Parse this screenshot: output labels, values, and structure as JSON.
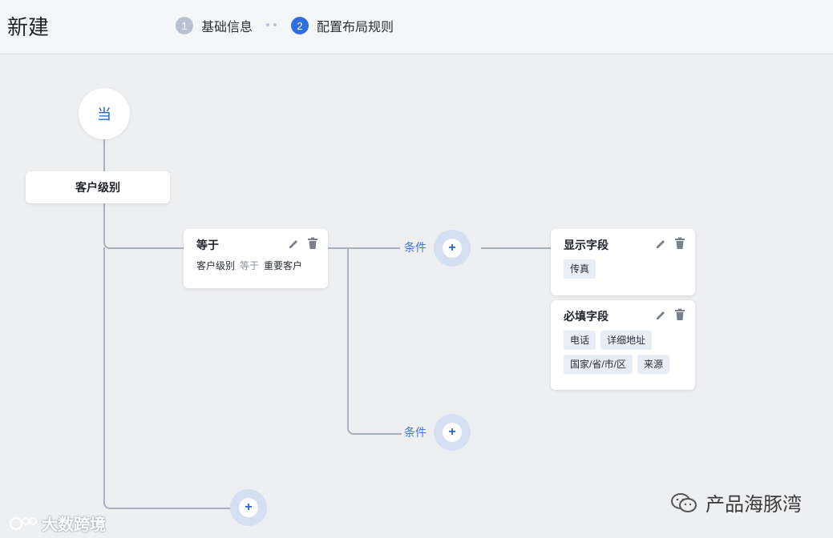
{
  "header": {
    "title": "新建",
    "steps": [
      {
        "num": "1",
        "label": "基础信息"
      },
      {
        "num": "2",
        "label": "配置布局规则"
      }
    ]
  },
  "flow": {
    "start_label": "当",
    "field_label": "客户级别",
    "condition_card": {
      "title": "等于",
      "field": "客户级别",
      "operator": "等于",
      "value": "重要客户"
    },
    "branch_label": "条件",
    "branch_label_2": "条件",
    "add_symbol": "+",
    "show_card": {
      "title": "显示字段",
      "tags": [
        "传真"
      ]
    },
    "required_card": {
      "title": "必填字段",
      "tags": [
        "电话",
        "详细地址",
        "国家/省/市/区",
        "来源"
      ]
    }
  },
  "watermarks": {
    "left": "大数跨境",
    "right": "产品海豚湾"
  },
  "colors": {
    "accent": "#2f6fe4",
    "link": "#3d79d6",
    "connector": "#a8b0bd",
    "add_ring": "#d5dff2",
    "tag_bg": "#e9edf5"
  }
}
